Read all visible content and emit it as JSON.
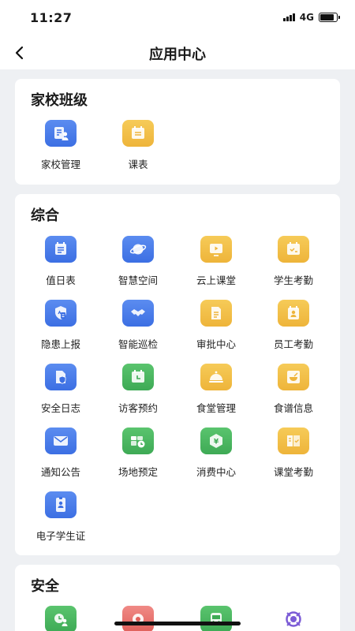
{
  "status": {
    "time": "11:27",
    "network": "4G",
    "battery_level": 0.85
  },
  "nav": {
    "title": "应用中心"
  },
  "sections": [
    {
      "title": "家校班级",
      "items": [
        {
          "label": "家校管理",
          "icon": "parents-icon",
          "color": "#4a7ff0"
        },
        {
          "label": "课表",
          "icon": "timetable-icon",
          "color": "#f2c04a"
        }
      ]
    },
    {
      "title": "综合",
      "items": [
        {
          "label": "值日表",
          "icon": "duty-list-icon",
          "color": "#4a7ff0"
        },
        {
          "label": "智慧空间",
          "icon": "planet-icon",
          "color": "#4a7ff0"
        },
        {
          "label": "云上课堂",
          "icon": "video-play-icon",
          "color": "#f2c04a"
        },
        {
          "label": "学生考勤",
          "icon": "calendar-check-icon",
          "color": "#f2c04a"
        },
        {
          "label": "隐患上报",
          "icon": "shield-report-icon",
          "color": "#4a7ff0"
        },
        {
          "label": "智能巡检",
          "icon": "handshake-icon",
          "color": "#4a7ff0"
        },
        {
          "label": "审批中心",
          "icon": "document-icon",
          "color": "#f2c04a"
        },
        {
          "label": "员工考勤",
          "icon": "badge-icon",
          "color": "#f2c04a"
        },
        {
          "label": "安全日志",
          "icon": "shield-doc-icon",
          "color": "#4a7ff0"
        },
        {
          "label": "访客预约",
          "icon": "calendar-clock-icon",
          "color": "#4caf61"
        },
        {
          "label": "食堂管理",
          "icon": "dish-cover-icon",
          "color": "#f2c04a"
        },
        {
          "label": "食谱信息",
          "icon": "bowl-icon",
          "color": "#f2c04a"
        },
        {
          "label": "通知公告",
          "icon": "mail-icon",
          "color": "#4a7ff0"
        },
        {
          "label": "场地预定",
          "icon": "venue-clock-icon",
          "color": "#4caf61"
        },
        {
          "label": "消费中心",
          "icon": "yen-shield-icon",
          "color": "#4caf61"
        },
        {
          "label": "课堂考勤",
          "icon": "book-check-icon",
          "color": "#f2c04a"
        },
        {
          "label": "电子学生证",
          "icon": "id-card-icon",
          "color": "#4a7ff0"
        }
      ]
    },
    {
      "title": "安全",
      "items": [
        {
          "label": "",
          "icon": "clock-user-icon",
          "color": "#4caf61"
        },
        {
          "label": "",
          "icon": "alarm-icon",
          "color": "#e0605b"
        },
        {
          "label": "",
          "icon": "bus-icon",
          "color": "#4caf61"
        },
        {
          "label": "",
          "icon": "camera-icon",
          "color": "#7b5bd6"
        }
      ]
    }
  ]
}
